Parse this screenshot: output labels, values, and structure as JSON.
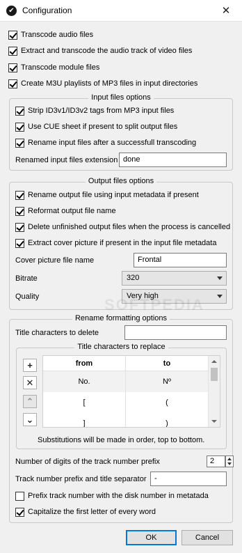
{
  "window": {
    "title": "Configuration",
    "close": "✕"
  },
  "options": [
    {
      "label": "Transcode audio files",
      "checked": true
    },
    {
      "label": "Extract and transcode the audio track of video files",
      "checked": true
    },
    {
      "label": "Transcode module files",
      "checked": true
    },
    {
      "label": "Create M3U playlists of MP3 files in input directories",
      "checked": true
    }
  ],
  "input_group": {
    "title": "Input files options",
    "options": [
      {
        "label": "Strip ID3v1/ID3v2 tags from MP3 input files",
        "checked": true
      },
      {
        "label": "Use CUE sheet if present to split output files",
        "checked": true
      },
      {
        "label": "Rename input files after a successfull transcoding",
        "checked": true
      }
    ],
    "ext_label": "Renamed input files extension",
    "ext_value": "done"
  },
  "output_group": {
    "title": "Output files options",
    "options": [
      {
        "label": "Rename output file using input metadata if present",
        "checked": true
      },
      {
        "label": "Reformat output file name",
        "checked": true
      },
      {
        "label": "Delete unfinished output files when the process is cancelled",
        "checked": true
      },
      {
        "label": "Extract cover picture if present in the input file metadata",
        "checked": true
      }
    ],
    "cover_label": "Cover picture file name",
    "cover_value": "Frontal",
    "bitrate_label": "Bitrate",
    "bitrate_value": "320",
    "quality_label": "Quality",
    "quality_value": "Very high"
  },
  "rename_group": {
    "title": "Rename formatting options",
    "delete_label": "Title characters to delete",
    "delete_value": "",
    "replace_title": "Title characters to replace",
    "side_buttons": {
      "add": "+",
      "remove": "✕",
      "up": "⌃",
      "down": "⌄"
    },
    "table": {
      "headers": [
        "from",
        "to"
      ],
      "rows": [
        [
          "No.",
          "Nº"
        ],
        [
          "[",
          "("
        ],
        [
          "]",
          ")"
        ]
      ]
    },
    "note": "Substitutions will be made in order, top to bottom.",
    "digits_label": "Number of digits of the track number prefix",
    "digits_value": "2",
    "separator_label": "Track number prefix and title separator",
    "separator_value": "-",
    "prefix_disk": {
      "label": "Prefix track number with the disk number in metatada",
      "checked": false
    },
    "capitalize": {
      "label": "Capitalize the first letter of every word",
      "checked": true
    }
  },
  "buttons": {
    "ok": "OK",
    "cancel": "Cancel"
  },
  "watermark": "SOFTPEDIA",
  "colors": {
    "accent": "#0078d7"
  }
}
